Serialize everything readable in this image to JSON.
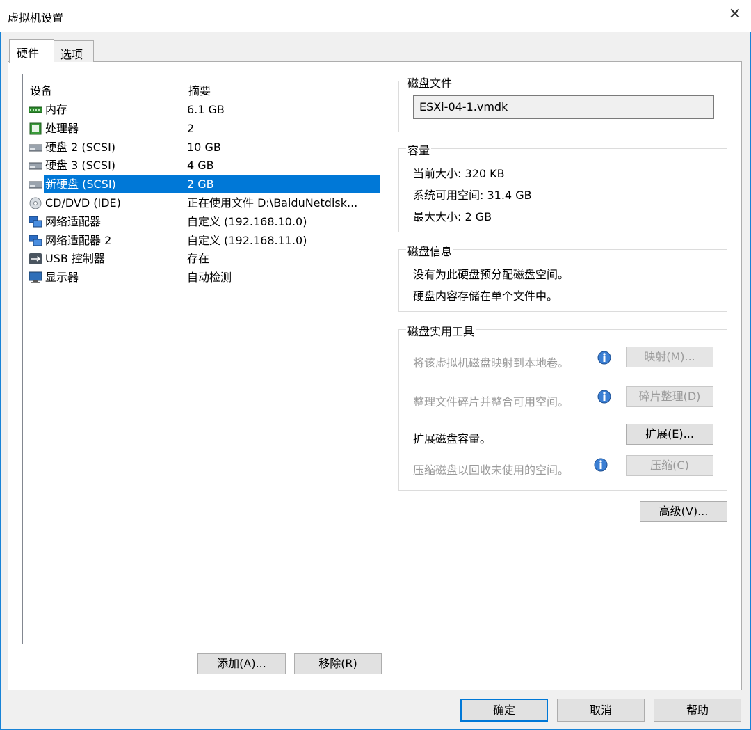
{
  "window": {
    "title": "虚拟机设置",
    "close": "✕"
  },
  "tabs": [
    "硬件",
    "选项"
  ],
  "devices": {
    "col_device": "设备",
    "col_summary": "摘要",
    "rows": [
      {
        "name": "内存",
        "summary": "6.1 GB",
        "icon": "memory-icon"
      },
      {
        "name": "处理器",
        "summary": "2",
        "icon": "processor-icon"
      },
      {
        "name": "硬盘 2 (SCSI)",
        "summary": "10 GB",
        "icon": "hard-disk-icon"
      },
      {
        "name": "硬盘 3 (SCSI)",
        "summary": "4 GB",
        "icon": "hard-disk-icon"
      },
      {
        "name": "新硬盘 (SCSI)",
        "summary": "2 GB",
        "icon": "hard-disk-icon",
        "selected": true
      },
      {
        "name": "CD/DVD (IDE)",
        "summary": "正在使用文件 D:\\BaiduNetdisk...",
        "icon": "cd-dvd-icon"
      },
      {
        "name": "网络适配器",
        "summary": "自定义 (192.168.10.0)",
        "icon": "network-adapter-icon"
      },
      {
        "name": "网络适配器 2",
        "summary": "自定义 (192.168.11.0)",
        "icon": "network-adapter-icon"
      },
      {
        "name": "USB 控制器",
        "summary": "存在",
        "icon": "usb-icon"
      },
      {
        "name": "显示器",
        "summary": "自动检测",
        "icon": "display-icon"
      }
    ],
    "add_button": "添加(A)...",
    "remove_button": "移除(R)"
  },
  "disk_file": {
    "legend": "磁盘文件",
    "value": "ESXi-04-1.vmdk"
  },
  "capacity": {
    "legend": "容量",
    "current_size": "当前大小: 320 KB",
    "available": "系统可用空间: 31.4 GB",
    "max_size": "最大大小: 2 GB"
  },
  "disk_info": {
    "legend": "磁盘信息",
    "line1": "没有为此硬盘预分配磁盘空间。",
    "line2": "硬盘内容存储在单个文件中。"
  },
  "utilities": {
    "legend": "磁盘实用工具",
    "map_text": "将该虚拟机磁盘映射到本地卷。",
    "map_button": "映射(M)...",
    "defrag_text": "整理文件碎片并整合可用空间。",
    "defrag_button": "碎片整理(D)",
    "expand_text": "扩展磁盘容量。",
    "expand_button": "扩展(E)...",
    "compact_text": "压缩磁盘以回收未使用的空间。",
    "compact_button": "压缩(C)"
  },
  "advanced_button": "高级(V)...",
  "footer": {
    "ok": "确定",
    "cancel": "取消",
    "help": "帮助"
  },
  "colors": {
    "selection": "#0078d7",
    "window_border": "#1883d7"
  }
}
